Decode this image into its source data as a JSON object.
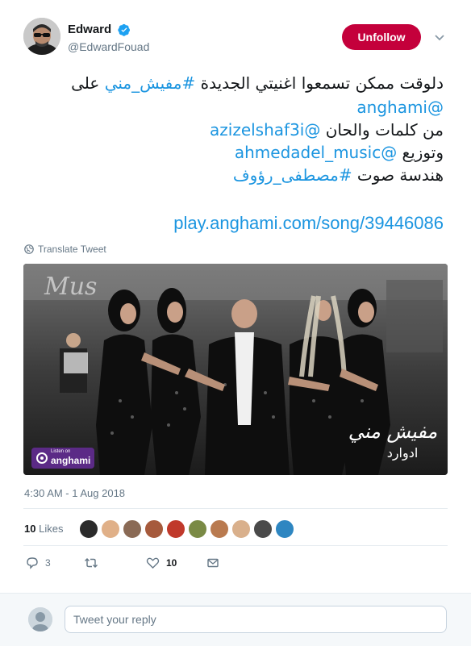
{
  "author": {
    "name": "Edward",
    "handle": "@EdwardFouad",
    "verified": true
  },
  "follow_button": {
    "label": "Unfollow",
    "color": "#c4003b"
  },
  "tweet": {
    "lines": [
      [
        {
          "text": "دلوقت ممكن تسمعوا اغنيتي الجديدة ",
          "link": false
        },
        {
          "text": "#مفيش_مني",
          "link": true
        },
        {
          "text": " على",
          "link": false
        }
      ],
      [
        {
          "text": "@anghami",
          "link": true
        }
      ],
      [
        {
          "text": "من كلمات والحان ",
          "link": false
        },
        {
          "text": "@azizelshaf3i",
          "link": true
        }
      ],
      [
        {
          "text": "وتوزيع ",
          "link": false
        },
        {
          "text": "@ahmedadel_music",
          "link": true
        }
      ],
      [
        {
          "text": "هندسة صوت ",
          "link": false
        },
        {
          "text": "#مصطفى_رؤوف",
          "link": true
        }
      ],
      [
        {
          "text": "play.anghami.com/song/39446086",
          "link": true
        }
      ]
    ],
    "link_color": "#1b95e0"
  },
  "translate": {
    "label": "Translate Tweet",
    "icon": "globe-icon"
  },
  "media": {
    "sign_text": "Mus",
    "title_art": "مفيش مني",
    "artist_art": "ادوارد",
    "badge_small": "Listen on",
    "badge_brand": "anghami",
    "badge_color": "#5b2a86"
  },
  "timestamp": "4:30 AM - 1 Aug 2018",
  "likes": {
    "count": "10",
    "label": "Likes"
  },
  "liker_colors": [
    "#2b2b2b",
    "#e0b088",
    "#8a6a55",
    "#a65a3c",
    "#c0392b",
    "#7a8a45",
    "#b97a4f",
    "#d9b08c",
    "#4a4a4a",
    "#2e86c1"
  ],
  "actions": {
    "reply_count": "3",
    "retweet_count": "",
    "like_count": "10",
    "icons": [
      "reply-icon",
      "retweet-icon",
      "heart-icon",
      "message-icon"
    ]
  },
  "reply_box": {
    "placeholder": "Tweet your reply"
  }
}
